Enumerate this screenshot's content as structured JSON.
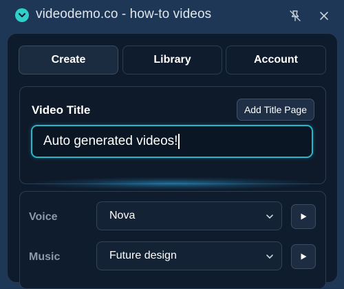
{
  "window": {
    "title": "videodemo.co - how-to videos",
    "icons": {
      "app": "chevron-down-icon",
      "pin": "unpin-icon",
      "close": "close-icon"
    }
  },
  "tabs": [
    {
      "label": "Create",
      "active": true
    },
    {
      "label": "Library",
      "active": false
    },
    {
      "label": "Account",
      "active": false
    }
  ],
  "video_title": {
    "label": "Video Title",
    "add_title_page_label": "Add Title Page",
    "value": "Auto generated videos!"
  },
  "settings": {
    "voice": {
      "label": "Voice",
      "selected": "Nova",
      "play_icon": "play-icon"
    },
    "music": {
      "label": "Music",
      "selected": "Future design",
      "play_icon": "play-icon"
    }
  },
  "colors": {
    "window_bg": "#1e3757",
    "panel_bg": "#0e1b2c",
    "accent": "#27b7c9",
    "app_icon": "#2fd0c9"
  }
}
